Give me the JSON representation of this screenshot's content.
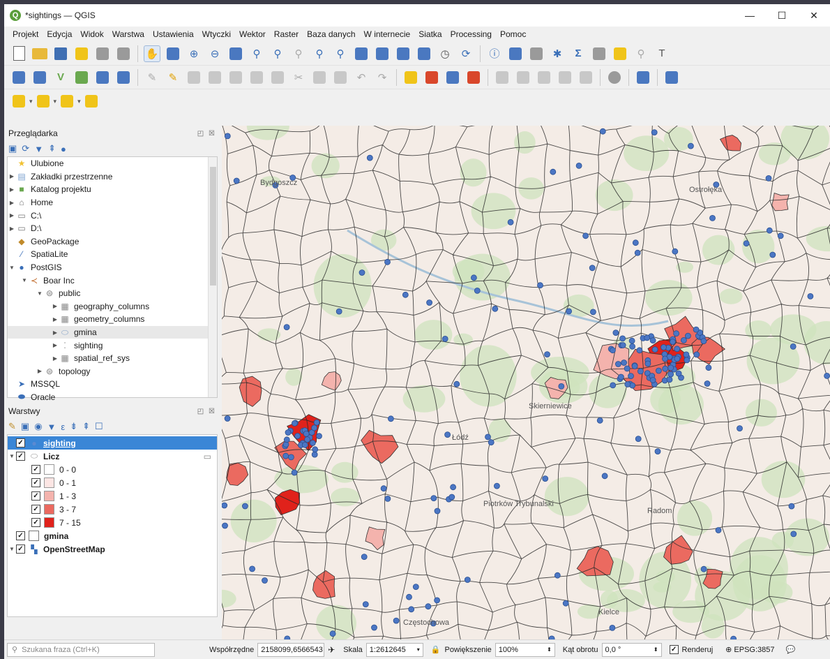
{
  "window": {
    "title": "*sightings — QGIS"
  },
  "menu": [
    "Projekt",
    "Edycja",
    "Widok",
    "Warstwa",
    "Ustawienia",
    "Wtyczki",
    "Wektor",
    "Raster",
    "Baza danych",
    "W internecie",
    "Siatka",
    "Processing",
    "Pomoc"
  ],
  "browser": {
    "title": "Przeglądarka",
    "items": [
      {
        "label": "Ulubione"
      },
      {
        "label": "Zakładki przestrzenne"
      },
      {
        "label": "Katalog projektu"
      },
      {
        "label": "Home"
      },
      {
        "label": "C:\\"
      },
      {
        "label": "D:\\"
      },
      {
        "label": "GeoPackage"
      },
      {
        "label": "SpatiaLite"
      },
      {
        "label": "PostGIS"
      },
      {
        "label": "Boar Inc"
      },
      {
        "label": "public"
      },
      {
        "label": "geography_columns"
      },
      {
        "label": "geometry_columns"
      },
      {
        "label": "gmina"
      },
      {
        "label": "sighting"
      },
      {
        "label": "spatial_ref_sys"
      },
      {
        "label": "topology"
      },
      {
        "label": "MSSQL"
      },
      {
        "label": "Oracle"
      }
    ]
  },
  "layers": {
    "title": "Warstwy",
    "items": [
      {
        "label": "sighting"
      },
      {
        "label": "Licz"
      },
      {
        "label": "0 - 0",
        "color": "#ffffff"
      },
      {
        "label": "0 - 1",
        "color": "#fde6e4"
      },
      {
        "label": "1 - 3",
        "color": "#f4b3ad"
      },
      {
        "label": "3 - 7",
        "color": "#eb6a60"
      },
      {
        "label": "7 - 15",
        "color": "#e0221b"
      },
      {
        "label": "gmina"
      },
      {
        "label": "OpenStreetMap"
      }
    ]
  },
  "map": {
    "place_labels": [
      "Bydgoszcz",
      "Ostrołęka",
      "Łódź",
      "Skierniewice",
      "Piotrków Trybunalski",
      "Radom",
      "Częstochowa",
      "Kielce"
    ]
  },
  "status": {
    "search_placeholder": "Szukana fraza (Ctrl+K)",
    "coord_label": "Współrzędne",
    "coord_value": "2158099,6566543",
    "scale_label": "Skala",
    "scale_value": "1:2612645",
    "magnifier_label": "Powiększenie",
    "magnifier_value": "100%",
    "rotation_label": "Kąt obrotu",
    "rotation_value": "0,0 °",
    "render_label": "Renderuj",
    "crs": "EPSG:3857"
  }
}
